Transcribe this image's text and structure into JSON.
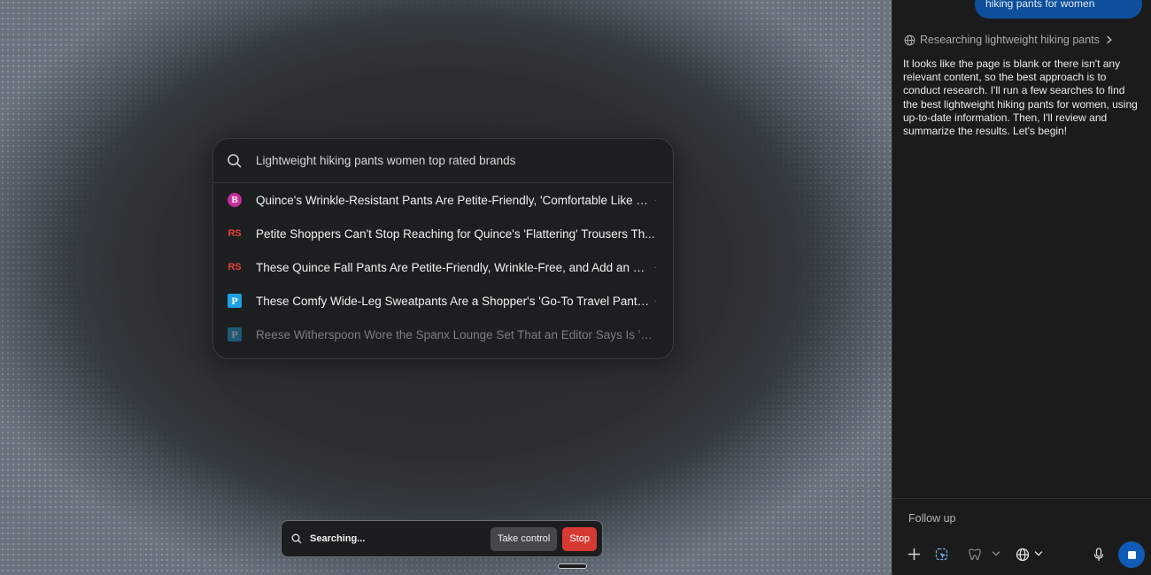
{
  "search": {
    "query": "Lightweight hiking pants women top rated brands",
    "results": [
      {
        "favicon": "B",
        "favicon_style": "circle-magenta",
        "title": "Quince's Wrinkle-Resistant Pants Are Petite-Friendly, 'Comfortable Like L...",
        "faded": false
      },
      {
        "favicon": "RS",
        "favicon_style": "red-letters",
        "title": "Petite Shoppers Can't Stop Reaching for Quince's 'Flattering' Trousers Th...",
        "faded": false
      },
      {
        "favicon": "RS",
        "favicon_style": "red-letters",
        "title": "These Quince Fall Pants Are Petite-Friendly, Wrinkle-Free, and Add an Ele...",
        "faded": false
      },
      {
        "favicon": "P",
        "favicon_style": "blue-square",
        "title": "These Comfy Wide-Leg Sweatpants Are a Shopper's 'Go-To Travel Pants'...",
        "faded": false
      },
      {
        "favicon": "P",
        "favicon_style": "blue-square",
        "title": "Reese Witherspoon Wore the Spanx Lounge Set That an Editor Says Is 'Ta...",
        "faded": true
      }
    ]
  },
  "status_bar": {
    "status": "Searching...",
    "take_control_label": "Take control",
    "stop_label": "Stop"
  },
  "chat": {
    "user_message": "hiking pants for women",
    "research_label": "Researching lightweight hiking pants",
    "assistant_message": "It looks like the page is blank or there isn't any relevant content, so the best approach is to conduct research. I'll run a few searches to find the best lightweight hiking pants for women, using up-to-date information. Then, I'll review and summarize the results. Let's begin!",
    "follow_up_placeholder": "Follow up"
  },
  "colors": {
    "accent_blue": "#0f5bb5",
    "user_bubble": "#0d4f9a",
    "stop_red": "#d63a33",
    "rs_red": "#e8443b",
    "b_magenta": "#c62f9a",
    "p_blue": "#1da0e4"
  },
  "icons": [
    "search-icon",
    "globe-icon",
    "chevron-right-icon",
    "plus-icon",
    "tools-icon",
    "tooth-icon",
    "chevron-down-icon",
    "microphone-icon",
    "stop-square-icon"
  ]
}
